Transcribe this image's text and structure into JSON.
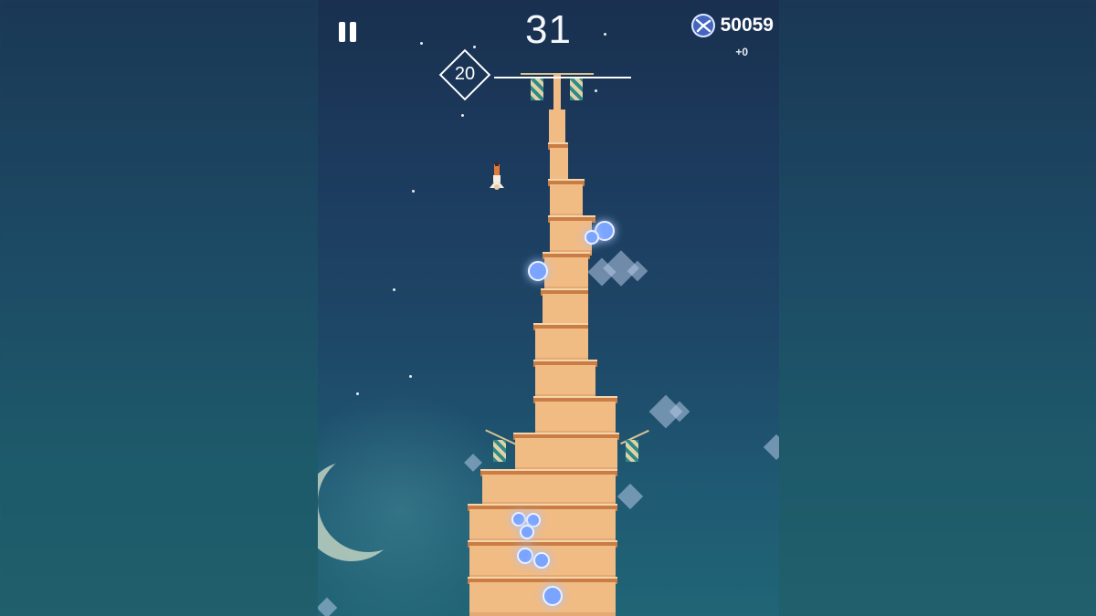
{
  "hud": {
    "score": "31",
    "coins": "50059",
    "coin_delta": "+0",
    "marker_level": "20"
  },
  "icons": {
    "pause": "pause-icon",
    "coin": "propeller-coin-icon"
  },
  "colors": {
    "sky_top": "#19304f",
    "sky_bottom": "#216576",
    "tower": "#f1bb84",
    "ledge": "#c97d44",
    "gem": "#7aa4ff"
  }
}
